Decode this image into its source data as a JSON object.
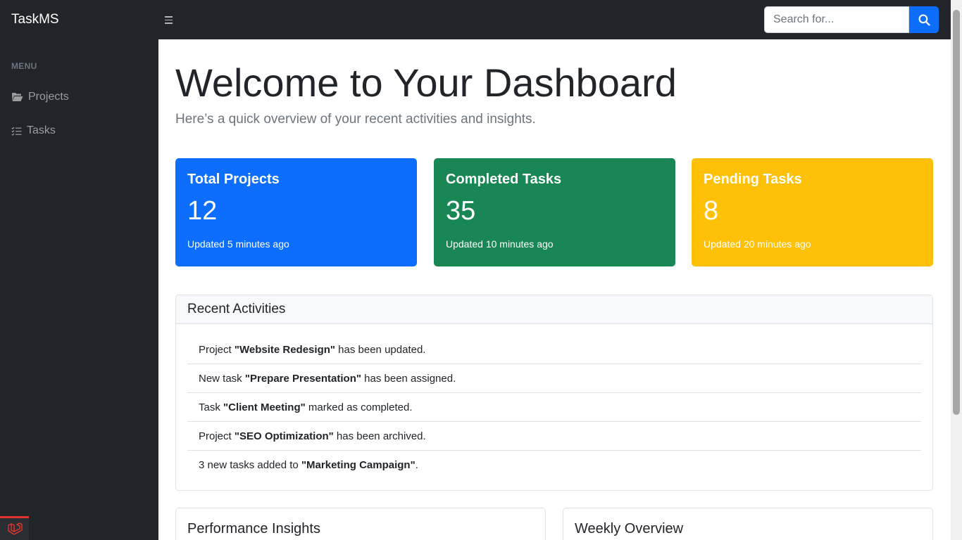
{
  "app": {
    "brand": "TaskMS"
  },
  "search": {
    "placeholder": "Search for..."
  },
  "sidebar": {
    "heading": "MENU",
    "items": [
      {
        "label": "Projects",
        "icon": "folder-open-icon"
      },
      {
        "label": "Tasks",
        "icon": "list-check-icon"
      }
    ]
  },
  "page": {
    "title": "Welcome to Your Dashboard",
    "lead": "Here’s a quick overview of your recent activities and insights."
  },
  "stats": [
    {
      "title": "Total Projects",
      "value": "12",
      "note": "Updated 5 minutes ago",
      "color": "#0d6efd"
    },
    {
      "title": "Completed Tasks",
      "value": "35",
      "note": "Updated 10 minutes ago",
      "color": "#198754"
    },
    {
      "title": "Pending Tasks",
      "value": "8",
      "note": "Updated 20 minutes ago",
      "color": "#ffc107"
    }
  ],
  "recent": {
    "title": "Recent Activities",
    "items": [
      {
        "pre": "Project ",
        "bold": "\"Website Redesign\"",
        "post": " has been updated."
      },
      {
        "pre": "New task ",
        "bold": "\"Prepare Presentation\"",
        "post": " has been assigned."
      },
      {
        "pre": "Task ",
        "bold": "\"Client Meeting\"",
        "post": " marked as completed."
      },
      {
        "pre": "Project ",
        "bold": "\"SEO Optimization\"",
        "post": " has been archived."
      },
      {
        "pre": "3 new tasks added to ",
        "bold": "\"Marketing Campaign\"",
        "post": "."
      }
    ]
  },
  "cards": {
    "performance_title": "Performance Insights",
    "weekly_title": "Weekly Overview"
  },
  "colors": {
    "primary": "#0d6efd",
    "success": "#198754",
    "warning": "#ffc107",
    "dark": "#212529",
    "laravel": "#e3342f"
  }
}
